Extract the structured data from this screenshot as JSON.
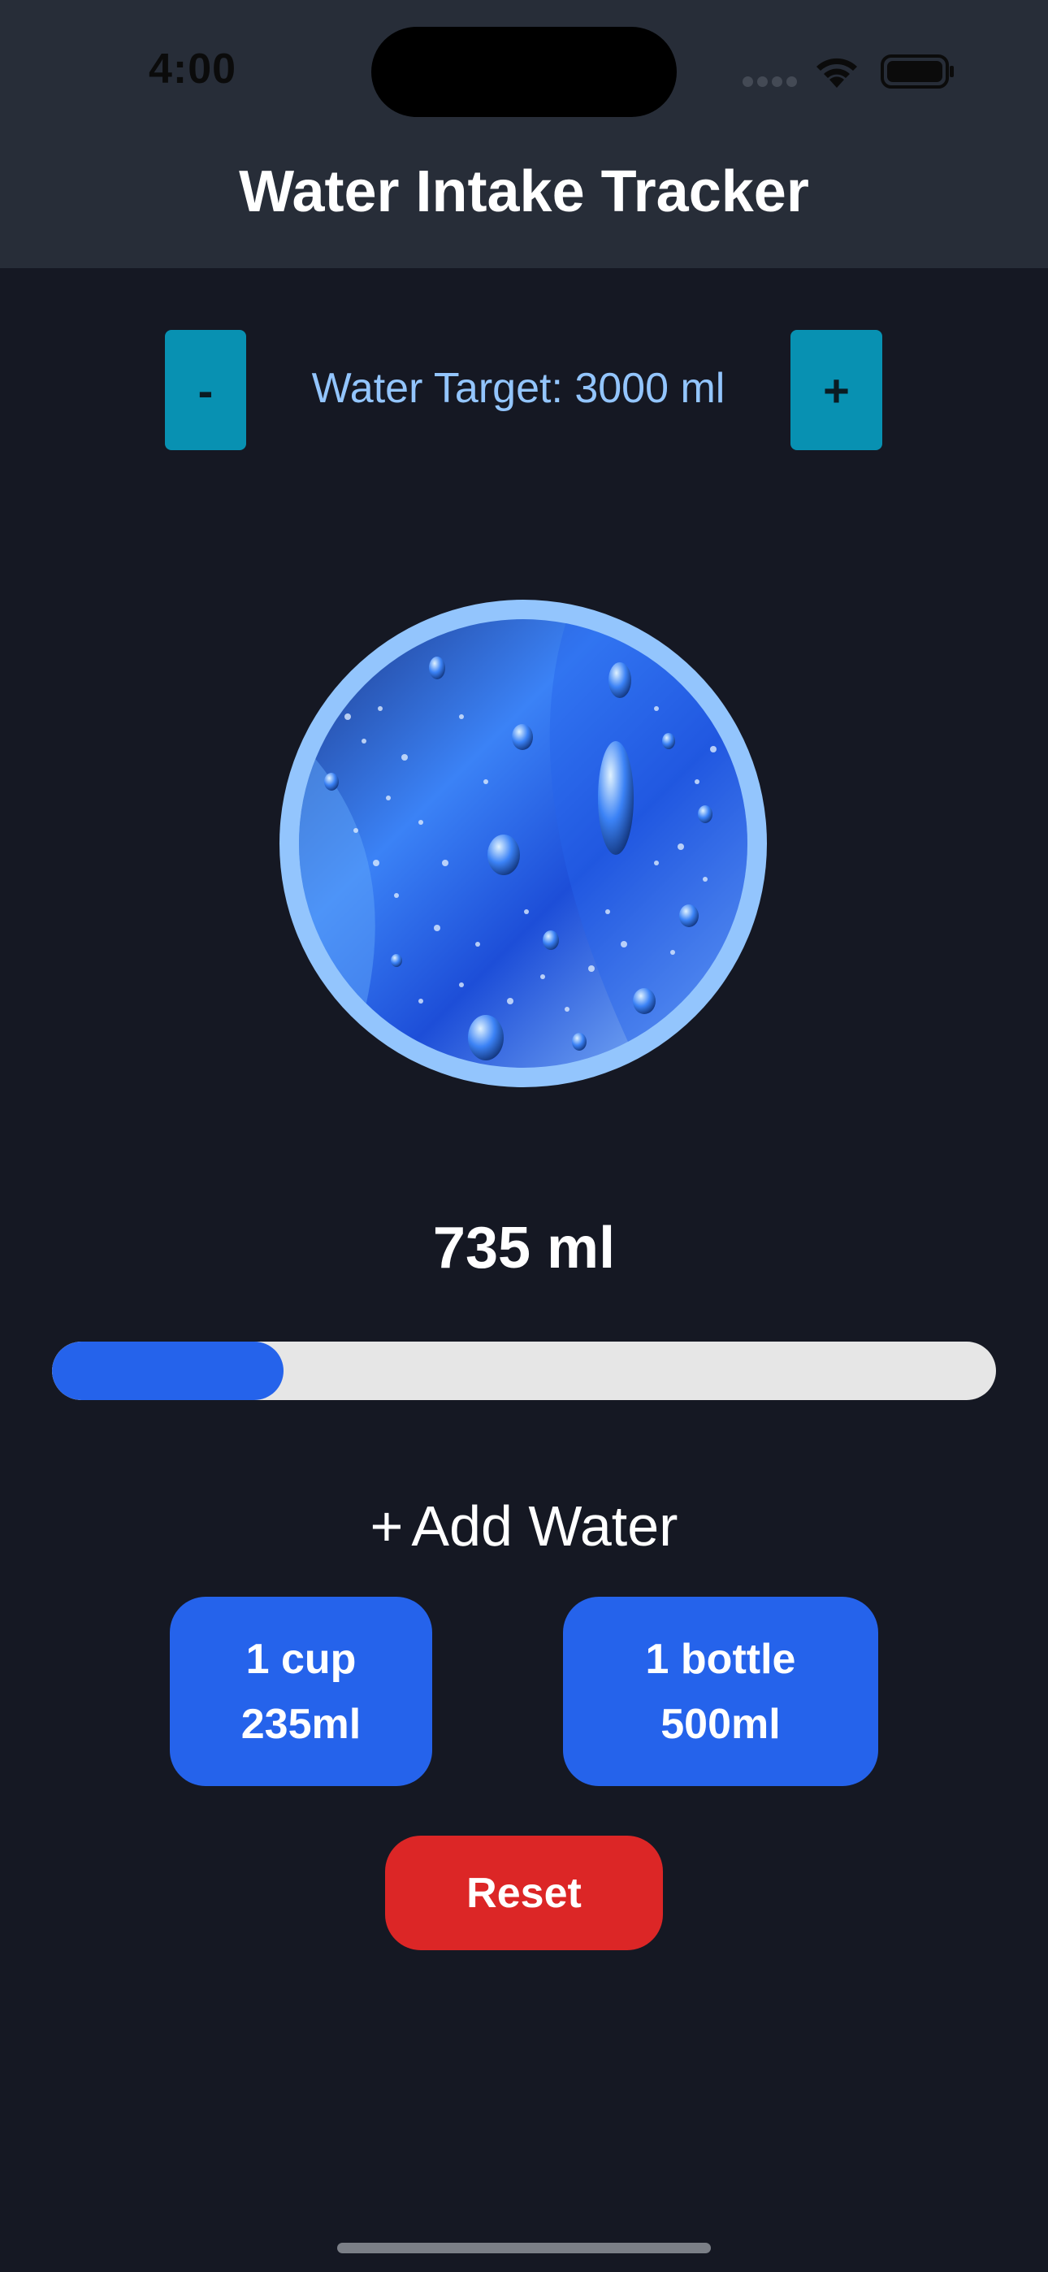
{
  "status_bar": {
    "time": "4:00",
    "icons": [
      "cellular-signal-icon",
      "wifi-icon",
      "battery-icon"
    ]
  },
  "header": {
    "title": "Water Intake Tracker"
  },
  "target": {
    "decrease_label": "-",
    "label": "Water Target: 3000 ml",
    "increase_label": "+"
  },
  "intake": {
    "amount_label": "735 ml",
    "progress_fraction": 0.245
  },
  "add_section": {
    "plus_symbol": "+",
    "title": "Add Water",
    "cup_line1": "1 cup",
    "cup_line2": "235ml",
    "bottle_line1": "1 bottle",
    "bottle_line2": "500ml"
  },
  "reset_label": "Reset",
  "colors": {
    "background": "#151823",
    "header": "#272d38",
    "accent_teal": "#0891b2",
    "accent_blue": "#2563eb",
    "reset_red": "#dc2626",
    "target_text": "#93c5fd"
  }
}
